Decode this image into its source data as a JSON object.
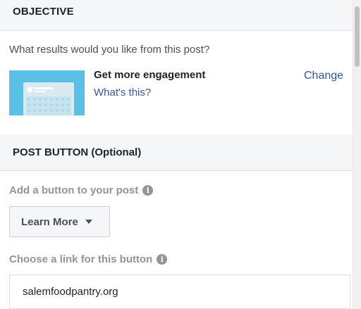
{
  "objective": {
    "header": "OBJECTIVE",
    "question": "What results would you like from this post?",
    "goal_title": "Get more engagement",
    "whats_this": "What's this?",
    "change": "Change",
    "thumbnail_icon": "engagement-thumbnail-icon"
  },
  "post_button": {
    "header": "POST BUTTON (Optional)",
    "add_label": "Add a button to your post",
    "selected_button": "Learn More",
    "link_label": "Choose a link for this button",
    "link_value": "salemfoodpantry.org",
    "info_icon_glyph": "i"
  },
  "colors": {
    "link": "#365899",
    "header_bg": "#f5f6f7",
    "thumbnail": "#5bc0e6"
  }
}
